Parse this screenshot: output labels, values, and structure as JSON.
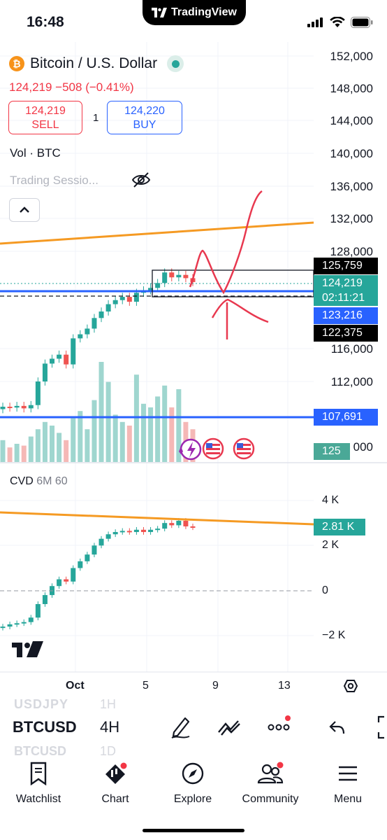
{
  "status_bar": {
    "time": "16:48",
    "app_pill": "TradingView"
  },
  "legend": {
    "symbol_badge": "₿",
    "title": "Bitcoin / U.S. Dollar",
    "price_change": "124,219  −508 (−0.41%)",
    "sell": {
      "price": "124,219",
      "label": "SELL"
    },
    "spread": "1",
    "buy": {
      "price": "124,220",
      "label": "BUY"
    },
    "volume_label": "Vol · BTC",
    "session_label": "Trading Sessio..."
  },
  "price_axis": {
    "labels": [
      "152,000",
      "148,000",
      "144,000",
      "140,000",
      "136,000",
      "132,000",
      "128,000",
      "116,000",
      "112,000"
    ],
    "tags": {
      "high": "125,759",
      "last": "124,219",
      "countdown": "02:11:21",
      "blue_line": "123,216",
      "low": "122,375",
      "support": "107,691",
      "volume": "125",
      "partial_label": "000"
    }
  },
  "cvd": {
    "name": "CVD",
    "params": "6M 60",
    "axis": [
      "4 K",
      "2 K",
      "0",
      "−2 K"
    ],
    "value_tag": "2.81 K"
  },
  "time_axis": [
    "Oct",
    "5",
    "9",
    "13"
  ],
  "toolbar": {
    "faded_above": {
      "symbol": "USDJPY",
      "interval": "1H"
    },
    "symbol": "BTCUSD",
    "interval": "4H",
    "faded_below": {
      "symbol": "BTCUSD",
      "interval": "1D"
    }
  },
  "bottom_nav": [
    {
      "label": "Watchlist"
    },
    {
      "label": "Chart"
    },
    {
      "label": "Explore"
    },
    {
      "label": "Community"
    },
    {
      "label": "Menu"
    }
  ],
  "chart_data": {
    "type": "candlestick",
    "ylim": [
      105000,
      153000
    ],
    "price_series": [
      108900,
      108800,
      109000,
      108700,
      109100,
      112000,
      114200,
      114800,
      115300,
      114100,
      117300,
      117800,
      118500,
      119800,
      120600,
      121500,
      122000,
      122400,
      121800,
      122900,
      123200,
      123500,
      124100,
      125400,
      124800,
      125100,
      124700,
      124219
    ],
    "volume_series": [
      12,
      8,
      10,
      9,
      14,
      18,
      22,
      20,
      16,
      12,
      24,
      28,
      18,
      34,
      55,
      44,
      26,
      22,
      20,
      48,
      32,
      30,
      36,
      42,
      30,
      40,
      22,
      18
    ],
    "cvd_series": [
      -1.6,
      -1.5,
      -1.45,
      -1.4,
      -1.2,
      -0.6,
      -0.2,
      0.2,
      0.5,
      0.4,
      1.0,
      1.3,
      1.6,
      2.0,
      2.3,
      2.5,
      2.6,
      2.65,
      2.6,
      2.7,
      2.6,
      2.7,
      2.75,
      3.0,
      2.9,
      3.1,
      2.85,
      2.81
    ],
    "colors": {
      "up": "#26a69a",
      "down": "#ef5350",
      "trend": "#f59a23",
      "level": "#2962ff",
      "drawing": "#e8384f"
    }
  }
}
